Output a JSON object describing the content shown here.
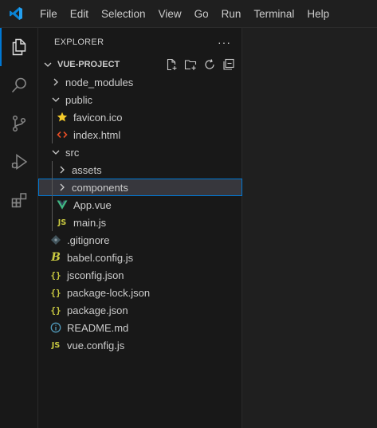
{
  "menu": [
    "File",
    "Edit",
    "Selection",
    "View",
    "Go",
    "Run",
    "Terminal",
    "Help"
  ],
  "activity_bar": [
    "explorer-icon",
    "search-icon",
    "source-control-icon",
    "run-debug-icon",
    "extensions-icon"
  ],
  "sidebar": {
    "title": "EXPLORER",
    "more": "···",
    "project": "VUE-PROJECT",
    "actions": [
      "new-file-icon",
      "new-folder-icon",
      "refresh-icon",
      "collapse-all-icon"
    ]
  },
  "tree": [
    {
      "label": "node_modules",
      "type": "folder",
      "expanded": false,
      "depth": 1
    },
    {
      "label": "public",
      "type": "folder",
      "expanded": true,
      "depth": 1
    },
    {
      "label": "favicon.ico",
      "type": "ico",
      "depth": 2
    },
    {
      "label": "index.html",
      "type": "html",
      "depth": 2
    },
    {
      "label": "src",
      "type": "folder",
      "expanded": true,
      "depth": 1
    },
    {
      "label": "assets",
      "type": "folder",
      "expanded": false,
      "depth": 2
    },
    {
      "label": "components",
      "type": "folder",
      "expanded": false,
      "depth": 2,
      "selected": true
    },
    {
      "label": "App.vue",
      "type": "vue",
      "depth": 2
    },
    {
      "label": "main.js",
      "type": "js",
      "depth": 2
    },
    {
      "label": ".gitignore",
      "type": "git",
      "depth": 1
    },
    {
      "label": "babel.config.js",
      "type": "babel",
      "depth": 1
    },
    {
      "label": "jsconfig.json",
      "type": "json",
      "depth": 1
    },
    {
      "label": "package-lock.json",
      "type": "json",
      "depth": 1
    },
    {
      "label": "package.json",
      "type": "json",
      "depth": 1
    },
    {
      "label": "README.md",
      "type": "info",
      "depth": 1
    },
    {
      "label": "vue.config.js",
      "type": "js",
      "depth": 1
    }
  ],
  "colors": {
    "accent": "#0078d4",
    "vue": "#41b883",
    "js": "#cbcb41",
    "json": "#cbcb41",
    "html": "#e44d26",
    "ico": "#f5cb2b",
    "info": "#519aba",
    "git": "#41535b",
    "babel": "#cbcb41"
  }
}
